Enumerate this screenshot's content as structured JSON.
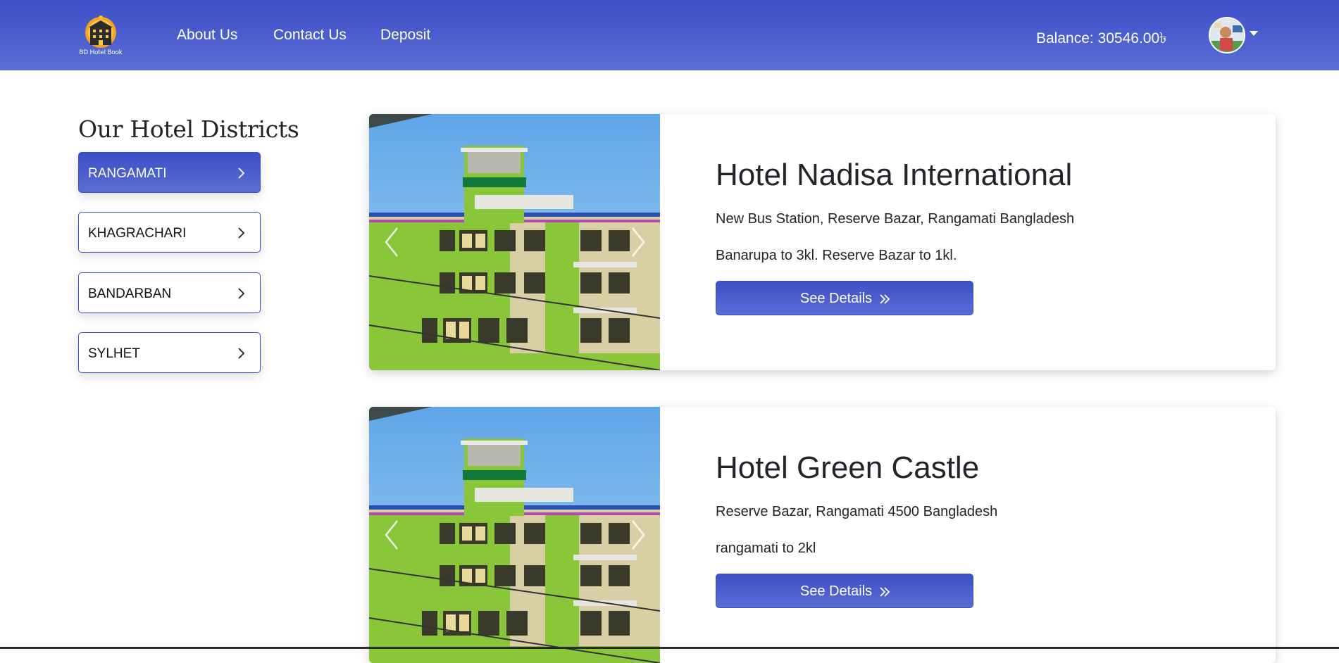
{
  "brand": {
    "logo_text": "BD Hotel Book",
    "accent": "#3d4fc6"
  },
  "nav": {
    "links": [
      "About Us",
      "Contact Us",
      "Deposit"
    ],
    "balance": "Balance: 30546.00৳"
  },
  "sidebar": {
    "title": "Our Hotel Districts",
    "districts": [
      {
        "label": "RANGAMATI",
        "active": true
      },
      {
        "label": "KHAGRACHARI",
        "active": false
      },
      {
        "label": "BANDARBAN",
        "active": false
      },
      {
        "label": "SYLHET",
        "active": false
      }
    ]
  },
  "hotels": [
    {
      "name": "Hotel Nadisa International",
      "address": "New Bus Station, Reserve Bazar, Rangamati Bangladesh",
      "distance": "Banarupa to 3kl. Reserve Bazar to 1kl.",
      "button": "See Details"
    },
    {
      "name": "Hotel Green Castle",
      "address": "Reserve Bazar, Rangamati 4500 Bangladesh",
      "distance": "rangamati to 2kl",
      "button": "See Details"
    }
  ]
}
